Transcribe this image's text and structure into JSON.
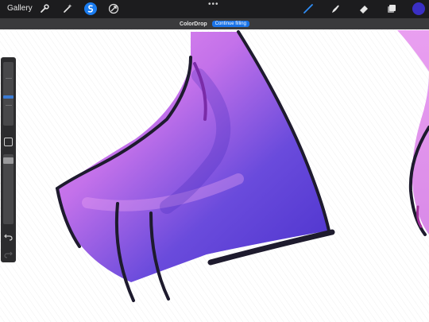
{
  "toolbar": {
    "gallery_label": "Gallery",
    "more_dots": "•••",
    "left_tools": [
      "wrench-icon",
      "magic-wand-icon",
      "selection-icon",
      "transform-icon"
    ],
    "right_tools": [
      "brush-icon",
      "smudge-icon",
      "eraser-icon",
      "layers-icon"
    ],
    "active_tool": "brush-icon",
    "current_color": "#3a2fc4"
  },
  "notice": {
    "title": "ColorDrop",
    "button_label": "Continue filling",
    "button_color": "#1a73e8"
  },
  "sidebar": {
    "size_level": 0.45,
    "opacity_level": 0.95,
    "icons": [
      "modify-square-icon",
      "undo-icon",
      "redo-icon"
    ]
  },
  "colors": {
    "toolbar_bg": "#1c1c1e",
    "fill_purple": "#5b3fd6",
    "fill_pink": "#e87bea",
    "outline": "#1e1b2e"
  }
}
